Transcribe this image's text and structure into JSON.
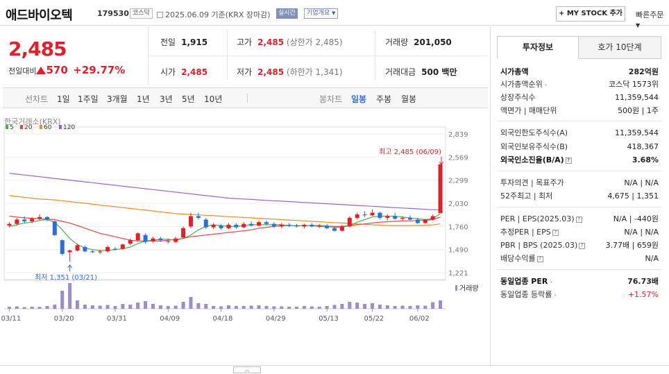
{
  "header": {
    "company": "애드바이오텍",
    "code": "179530",
    "market": "코스닥",
    "date": "2025.06.09",
    "basis": "기준(KRX 장마감)",
    "realtime": "실시간",
    "overview": "기업개요",
    "mystock": "+ MY STOCK 추가",
    "quick": "빠른주문"
  },
  "price": {
    "current": "2,485",
    "change_label": "전일대비",
    "change": "570",
    "change_pct": "+29.77%"
  },
  "stats": {
    "prev_label": "전일",
    "prev": "1,915",
    "high_label": "고가",
    "high": "2,485",
    "high_sub": "(상한가 2,485)",
    "volume_label": "거래량",
    "volume": "201,050",
    "open_label": "시가",
    "open": "2,485",
    "low_label": "저가",
    "low": "2,485",
    "low_sub": "(하한가 1,341)",
    "amount_label": "거래대금",
    "amount": "500 백만"
  },
  "toolbar": {
    "line_label": "선차트",
    "d1": "1일",
    "w1": "1주일",
    "m3": "3개월",
    "y1": "1년",
    "y3": "3년",
    "y5": "5년",
    "y10": "10년",
    "candle_label": "봉차트",
    "daily": "일봉",
    "weekly": "주봉",
    "monthly": "월봉"
  },
  "chart_data": {
    "type": "candlestick",
    "exchange": "한국거래소(KRX)",
    "legend": [
      {
        "name": "5",
        "color": "#4caf50"
      },
      {
        "name": "20",
        "color": "#e8433e"
      },
      {
        "name": "60",
        "color": "#f08a24"
      },
      {
        "name": "120",
        "color": "#a060c8"
      }
    ],
    "y_ticks": [
      "2,839",
      "2,569",
      "2,299",
      "2,030",
      "1,760",
      "1,490",
      "1,221"
    ],
    "ylim": [
      1221,
      2839
    ],
    "x_ticks": [
      {
        "label": "03/11",
        "i": 0
      },
      {
        "label": "03/20",
        "i": 7
      },
      {
        "label": "03/31",
        "i": 14
      },
      {
        "label": "04/09",
        "i": 21
      },
      {
        "label": "04/18",
        "i": 28
      },
      {
        "label": "04/29",
        "i": 35
      },
      {
        "label": "05/13",
        "i": 42
      },
      {
        "label": "05/22",
        "i": 48
      },
      {
        "label": "06/02",
        "i": 54
      }
    ],
    "high_annot": "최고 2,485 (06/09)",
    "low_annot": "최저 1,351 (03/21)",
    "volume_label": "거래량",
    "candles": [
      [
        1770,
        1810,
        1750,
        1790
      ],
      [
        1790,
        1860,
        1770,
        1840
      ],
      [
        1840,
        1880,
        1800,
        1820
      ],
      [
        1820,
        1870,
        1800,
        1850
      ],
      [
        1850,
        1900,
        1830,
        1870
      ],
      [
        1870,
        1880,
        1820,
        1840
      ],
      [
        1820,
        1830,
        1650,
        1660
      ],
      [
        1600,
        1610,
        1420,
        1440
      ],
      [
        1460,
        1490,
        1351,
        1480
      ],
      [
        1480,
        1560,
        1470,
        1540
      ],
      [
        1520,
        1540,
        1460,
        1470
      ],
      [
        1470,
        1490,
        1450,
        1460
      ],
      [
        1460,
        1490,
        1440,
        1470
      ],
      [
        1470,
        1540,
        1460,
        1520
      ],
      [
        1500,
        1520,
        1480,
        1490
      ],
      [
        1500,
        1560,
        1490,
        1550
      ],
      [
        1560,
        1620,
        1540,
        1600
      ],
      [
        1600,
        1690,
        1590,
        1680
      ],
      [
        1660,
        1680,
        1560,
        1580
      ],
      [
        1590,
        1640,
        1570,
        1620
      ],
      [
        1620,
        1640,
        1580,
        1600
      ],
      [
        1590,
        1620,
        1560,
        1580
      ],
      [
        1580,
        1640,
        1570,
        1620
      ],
      [
        1630,
        1760,
        1620,
        1740
      ],
      [
        1760,
        1920,
        1740,
        1880
      ],
      [
        1880,
        1920,
        1840,
        1860
      ],
      [
        1840,
        1860,
        1730,
        1750
      ],
      [
        1750,
        1800,
        1730,
        1780
      ],
      [
        1770,
        1790,
        1720,
        1740
      ],
      [
        1740,
        1800,
        1730,
        1780
      ],
      [
        1780,
        1800,
        1730,
        1750
      ],
      [
        1750,
        1810,
        1740,
        1790
      ],
      [
        1790,
        1820,
        1760,
        1770
      ],
      [
        1770,
        1830,
        1760,
        1810
      ],
      [
        1810,
        1830,
        1770,
        1790
      ],
      [
        1790,
        1810,
        1740,
        1760
      ],
      [
        1760,
        1800,
        1740,
        1780
      ],
      [
        1780,
        1800,
        1750,
        1770
      ],
      [
        1770,
        1790,
        1750,
        1760
      ],
      [
        1760,
        1790,
        1740,
        1780
      ],
      [
        1780,
        1800,
        1750,
        1760
      ],
      [
        1760,
        1790,
        1740,
        1770
      ],
      [
        1770,
        1790,
        1730,
        1740
      ],
      [
        1740,
        1760,
        1700,
        1710
      ],
      [
        1710,
        1780,
        1700,
        1760
      ],
      [
        1760,
        1880,
        1750,
        1860
      ],
      [
        1860,
        1920,
        1840,
        1900
      ],
      [
        1900,
        1940,
        1870,
        1890
      ],
      [
        1890,
        1960,
        1880,
        1920
      ],
      [
        1920,
        1930,
        1840,
        1860
      ],
      [
        1860,
        1900,
        1830,
        1880
      ],
      [
        1880,
        1920,
        1840,
        1850
      ],
      [
        1850,
        1880,
        1820,
        1860
      ],
      [
        1860,
        1890,
        1830,
        1840
      ],
      [
        1840,
        1860,
        1790,
        1800
      ],
      [
        1800,
        1850,
        1790,
        1840
      ],
      [
        1840,
        1900,
        1830,
        1880
      ],
      [
        1915,
        2485,
        1915,
        2485
      ]
    ],
    "volume": [
      30,
      35,
      25,
      30,
      28,
      40,
      60,
      260,
      370,
      120,
      60,
      50,
      45,
      55,
      40,
      70,
      60,
      90,
      110,
      70,
      50,
      40,
      45,
      100,
      170,
      80,
      70,
      40,
      35,
      50,
      40,
      40,
      45,
      50,
      40,
      35,
      35,
      30,
      30,
      40,
      35,
      30,
      40,
      55,
      70,
      100,
      90,
      70,
      80,
      60,
      50,
      40,
      45,
      40,
      50,
      45,
      95,
      120
    ],
    "ma5": [
      1760,
      1780,
      1800,
      1810,
      1830,
      1840,
      1810,
      1720,
      1620,
      1550,
      1510,
      1490,
      1480,
      1480,
      1490,
      1500,
      1520,
      1560,
      1590,
      1600,
      1610,
      1610,
      1600,
      1620,
      1660,
      1720,
      1760,
      1780,
      1770,
      1760,
      1760,
      1770,
      1780,
      1780,
      1780,
      1780,
      1780,
      1770,
      1770,
      1770,
      1770,
      1760,
      1760,
      1750,
      1750,
      1770,
      1810,
      1840,
      1870,
      1880,
      1880,
      1880,
      1870,
      1860,
      1850,
      1840,
      1850,
      1910
    ],
    "ma20": [
      1880,
      1870,
      1860,
      1855,
      1850,
      1845,
      1840,
      1820,
      1800,
      1770,
      1740,
      1710,
      1680,
      1660,
      1640,
      1620,
      1600,
      1590,
      1590,
      1590,
      1590,
      1600,
      1610,
      1620,
      1640,
      1650,
      1660,
      1670,
      1680,
      1690,
      1700,
      1710,
      1720,
      1740,
      1750,
      1760,
      1770,
      1770,
      1770,
      1770,
      1770,
      1770,
      1765,
      1760,
      1760,
      1770,
      1780,
      1790,
      1800,
      1810,
      1815,
      1820,
      1825,
      1825,
      1830,
      1830,
      1840,
      1870
    ],
    "ma60": [
      2120,
      2110,
      2100,
      2090,
      2080,
      2075,
      2070,
      2060,
      2050,
      2040,
      2030,
      2020,
      2010,
      2000,
      1990,
      1980,
      1970,
      1960,
      1950,
      1940,
      1930,
      1920,
      1910,
      1905,
      1900,
      1895,
      1890,
      1885,
      1880,
      1875,
      1870,
      1865,
      1860,
      1855,
      1850,
      1845,
      1840,
      1835,
      1830,
      1825,
      1820,
      1815,
      1810,
      1805,
      1800,
      1795,
      1790,
      1785,
      1780,
      1775,
      1772,
      1770,
      1770,
      1770,
      1772,
      1775,
      1778,
      1790
    ],
    "ma120": [
      2380,
      2370,
      2360,
      2350,
      2340,
      2330,
      2320,
      2310,
      2300,
      2290,
      2280,
      2270,
      2260,
      2250,
      2240,
      2230,
      2220,
      2210,
      2200,
      2190,
      2180,
      2170,
      2160,
      2150,
      2140,
      2130,
      2120,
      2110,
      2100,
      2090,
      2085,
      2080,
      2075,
      2070,
      2065,
      2060,
      2055,
      2050,
      2045,
      2040,
      2035,
      2030,
      2025,
      2020,
      2015,
      2010,
      2005,
      2000,
      1995,
      1990,
      1985,
      1980,
      1975,
      1970,
      1965,
      1960,
      1955,
      1955
    ]
  },
  "panel": {
    "tab_active": "투자정보",
    "tab_inactive": "호가 10단계",
    "rows": [
      {
        "k": "시가총액",
        "v": "282억원",
        "bold": true
      },
      {
        "k": "시가총액순위",
        "v": "코스닥 1573위",
        "caret": true
      },
      {
        "k": "상장주식수",
        "v": "11,359,544"
      },
      {
        "k": "액면가 | 매매단위",
        "v": "500원 | 1주"
      },
      {
        "k": "외국인한도주식수(A)",
        "v": "11,359,544"
      },
      {
        "k": "외국인보유주식수(B)",
        "v": "418,367"
      },
      {
        "k": "외국인소진율(B/A)",
        "v": "3.68%",
        "bold": true,
        "q": true
      },
      {
        "k": "투자의견 | 목표주가",
        "v": "N/A | N/A"
      },
      {
        "k": "52주최고 | 최저",
        "v": "4,675 | 1,351"
      },
      {
        "k": "PER | EPS(2025.03)",
        "v": "N/A | -440원",
        "q": true
      },
      {
        "k": "추정PER | EPS",
        "v": "N/A | N/A",
        "q": true
      },
      {
        "k": "PBR | BPS (2025.03)",
        "v": "3.77배 | 659원",
        "q": true
      },
      {
        "k": "배당수익률",
        "v": "N/A",
        "q": true
      },
      {
        "k": "동일업종 PER",
        "v": "76.73배",
        "bold": true,
        "caret": true
      },
      {
        "k": "동일업종 등락률",
        "v": "+1.57%",
        "caret": true,
        "red": true
      }
    ]
  }
}
